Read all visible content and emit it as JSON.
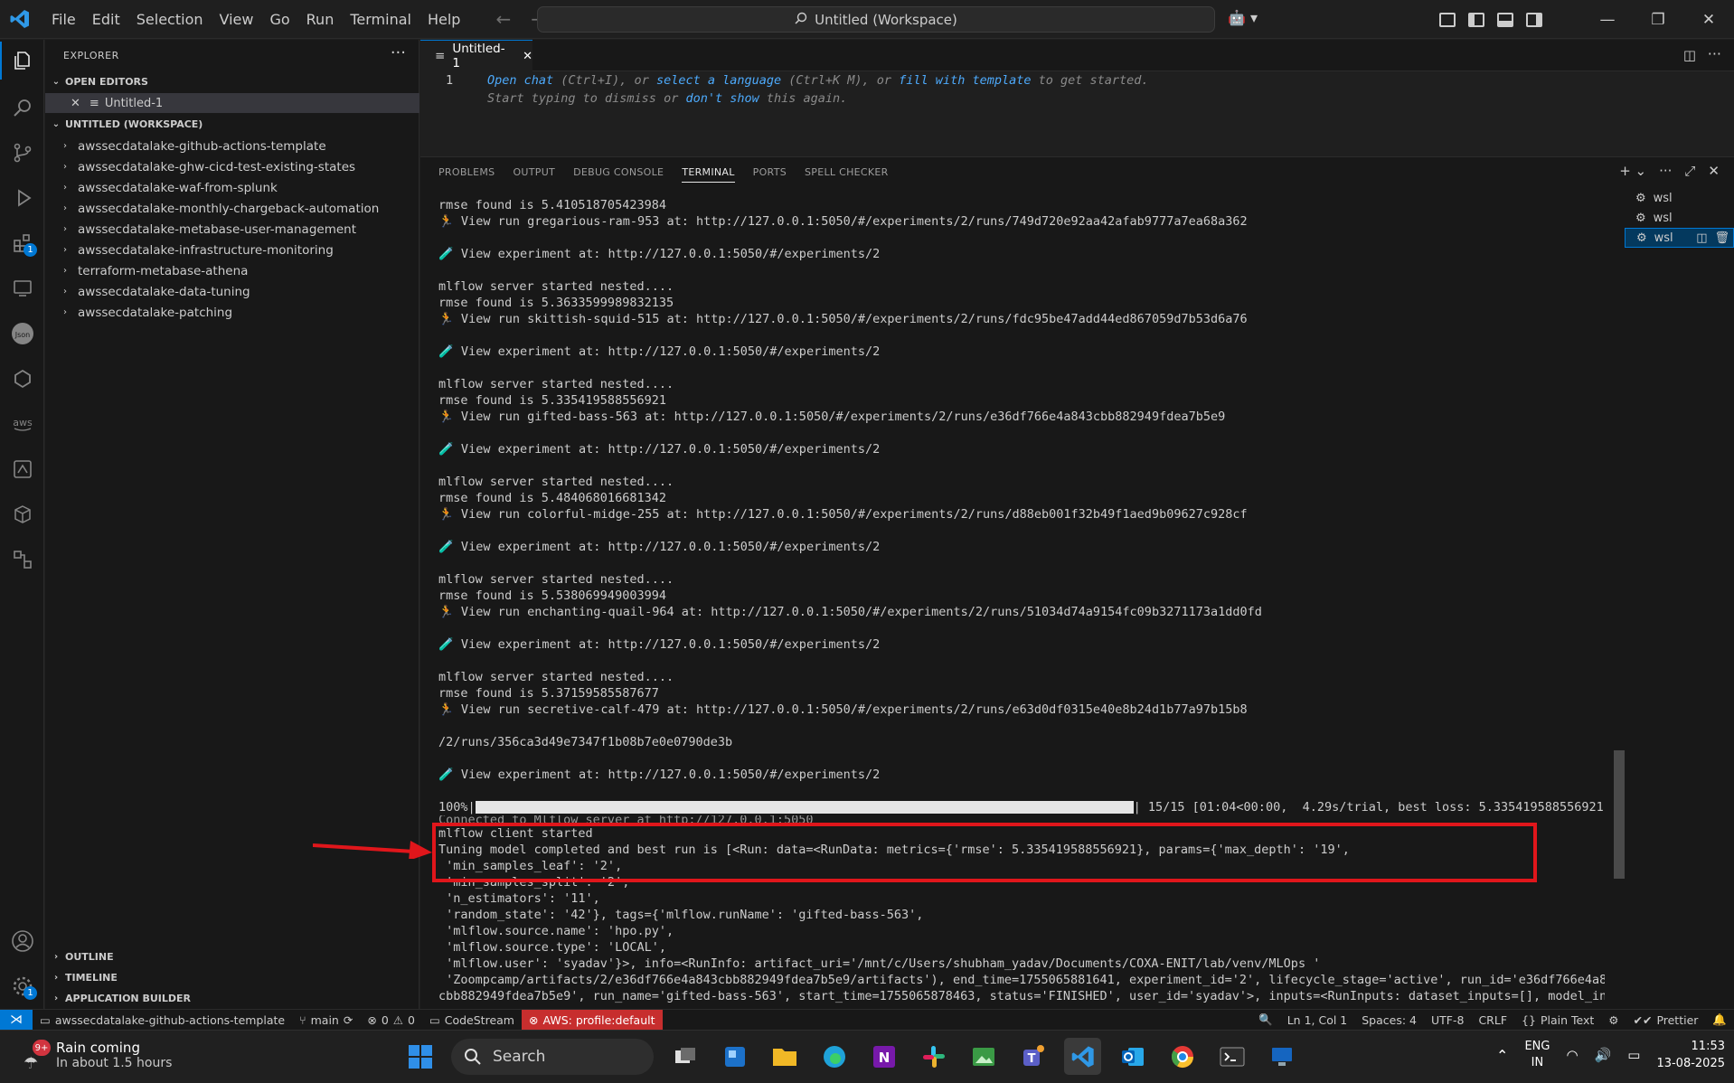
{
  "menu": [
    "File",
    "Edit",
    "Selection",
    "View",
    "Go",
    "Run",
    "Terminal",
    "Help"
  ],
  "command_center": "Untitled (Workspace)",
  "explorer": {
    "title": "EXPLORER",
    "open_editors_label": "OPEN EDITORS",
    "open_editor_file": "Untitled-1",
    "workspace_label": "UNTITLED (WORKSPACE)",
    "folders": [
      "awssecdatalake-github-actions-template",
      "awssecdatalake-ghw-cicd-test-existing-states",
      "awssecdatalake-waf-from-splunk",
      "awssecdatalake-monthly-chargeback-automation",
      "awssecdatalake-metabase-user-management",
      "awssecdatalake-infrastructure-monitoring",
      "terraform-metabase-athena",
      "awssecdatalake-data-tuning",
      "awssecdatalake-patching"
    ],
    "outline": "OUTLINE",
    "timeline": "TIMELINE",
    "app_builder": "APPLICATION BUILDER"
  },
  "editor": {
    "tab": "Untitled-1",
    "line_number": "1",
    "hint": {
      "open_chat": "Open chat",
      "open_chat_key": " (Ctrl+I), or ",
      "select_lang": "select a language",
      "select_lang_key": " (Ctrl+K M), or ",
      "fill": "fill with template",
      "tail": " to get started.",
      "line2_a": "Start typing to dismiss or ",
      "dont_show": "don't show",
      "line2_b": " this again."
    }
  },
  "panel": {
    "tabs": [
      "PROBLEMS",
      "OUTPUT",
      "DEBUG CONSOLE",
      "TERMINAL",
      "PORTS",
      "SPELL CHECKER"
    ],
    "active_tab": "TERMINAL",
    "terminals": [
      "wsl",
      "wsl",
      "wsl"
    ],
    "progress_pct": "100%|",
    "progress_tail": "| 15/15 [01:04<00:00,  4.29s/trial, best loss: 5.335419588556921]",
    "progress_fraction": 1.0,
    "lines": [
      "rmse found is 5.410518705423984",
      "🏃 View run gregarious-ram-953 at: http://127.0.0.1:5050/#/experiments/2/runs/749d720e92aa42afab9777a7ea68a362",
      "",
      "🧪 View experiment at: http://127.0.0.1:5050/#/experiments/2",
      "",
      "mlflow server started nested....",
      "rmse found is 5.3633599989832135",
      "🏃 View run skittish-squid-515 at: http://127.0.0.1:5050/#/experiments/2/runs/fdc95be47add44ed867059d7b53d6a76",
      "",
      "🧪 View experiment at: http://127.0.0.1:5050/#/experiments/2",
      "",
      "mlflow server started nested....",
      "rmse found is 5.335419588556921",
      "🏃 View run gifted-bass-563 at: http://127.0.0.1:5050/#/experiments/2/runs/e36df766e4a843cbb882949fdea7b5e9",
      "",
      "🧪 View experiment at: http://127.0.0.1:5050/#/experiments/2",
      "",
      "mlflow server started nested....",
      "rmse found is 5.484068016681342",
      "🏃 View run colorful-midge-255 at: http://127.0.0.1:5050/#/experiments/2/runs/d88eb001f32b49f1aed9b09627c928cf",
      "",
      "🧪 View experiment at: http://127.0.0.1:5050/#/experiments/2",
      "",
      "mlflow server started nested....",
      "rmse found is 5.538069949003994",
      "🏃 View run enchanting-quail-964 at: http://127.0.0.1:5050/#/experiments/2/runs/51034d74a9154fc09b3271173a1dd0fd",
      "",
      "🧪 View experiment at: http://127.0.0.1:5050/#/experiments/2",
      "",
      "mlflow server started nested....",
      "rmse found is 5.37159585587677",
      "🏃 View run secretive-calf-479 at: http://127.0.0.1:5050/#/experiments/2/runs/e63d0df0315e40e8b24d1b77a97b15b8",
      "",
      "/2/runs/356ca3d49e7347f1b08b7e0e0790de3b",
      "",
      "🧪 View experiment at: http://127.0.0.1:5050/#/experiments/2",
      ""
    ],
    "lines_after": [
      "Connected to Mlflow server at http://127.0.0.1:5050",
      "mlflow client started",
      "Tuning model completed and best run is [<Run: data=<RunData: metrics={'rmse': 5.335419588556921}, params={'max_depth': '19',",
      " 'min_samples_leaf': '2',",
      " 'min_samples_split': '2',",
      " 'n_estimators': '11',",
      " 'random_state': '42'}, tags={'mlflow.runName': 'gifted-bass-563',",
      " 'mlflow.source.name': 'hpo.py',",
      " 'mlflow.source.type': 'LOCAL',",
      " 'mlflow.user': 'syadav'}>, info=<RunInfo: artifact_uri='/mnt/c/Users/shubham_yadav/Documents/COXA-ENIT/lab/venv/MLOps '",
      " 'Zoompcamp/artifacts/2/e36df766e4a843cbb882949fdea7b5e9/artifacts'), end_time=1755065881641, experiment_id='2', lifecycle_stage='active', run_id='e36df766e4a843",
      "cbb882949fdea7b5e9', run_name='gifted-bass-563', start_time=1755065878463, status='FINISHED', user_id='syadav'>, inputs=<RunInputs: dataset_inputs=[], model_inpu"
    ]
  },
  "status": {
    "repo": "awssecdatalake-github-actions-template",
    "branch": "main",
    "problems": "0",
    "warnings": "0",
    "codestream": "CodeStream",
    "aws": "AWS: profile:default",
    "position": "Ln 1, Col 1",
    "spaces": "Spaces: 4",
    "encoding": "UTF-8",
    "eol": "CRLF",
    "language": "Plain Text",
    "prettier": "Prettier"
  },
  "taskbar": {
    "weather_title": "Rain coming",
    "weather_sub": "In about 1.5 hours",
    "weather_badge": "9+",
    "search": "Search",
    "lang": "ENG",
    "region": "IN",
    "time": "11:53",
    "date": "13-08-2025"
  },
  "colors": {
    "accent": "#0078d4",
    "highlight_box": "#e0161b",
    "aws_badge": "#c72e2e"
  }
}
